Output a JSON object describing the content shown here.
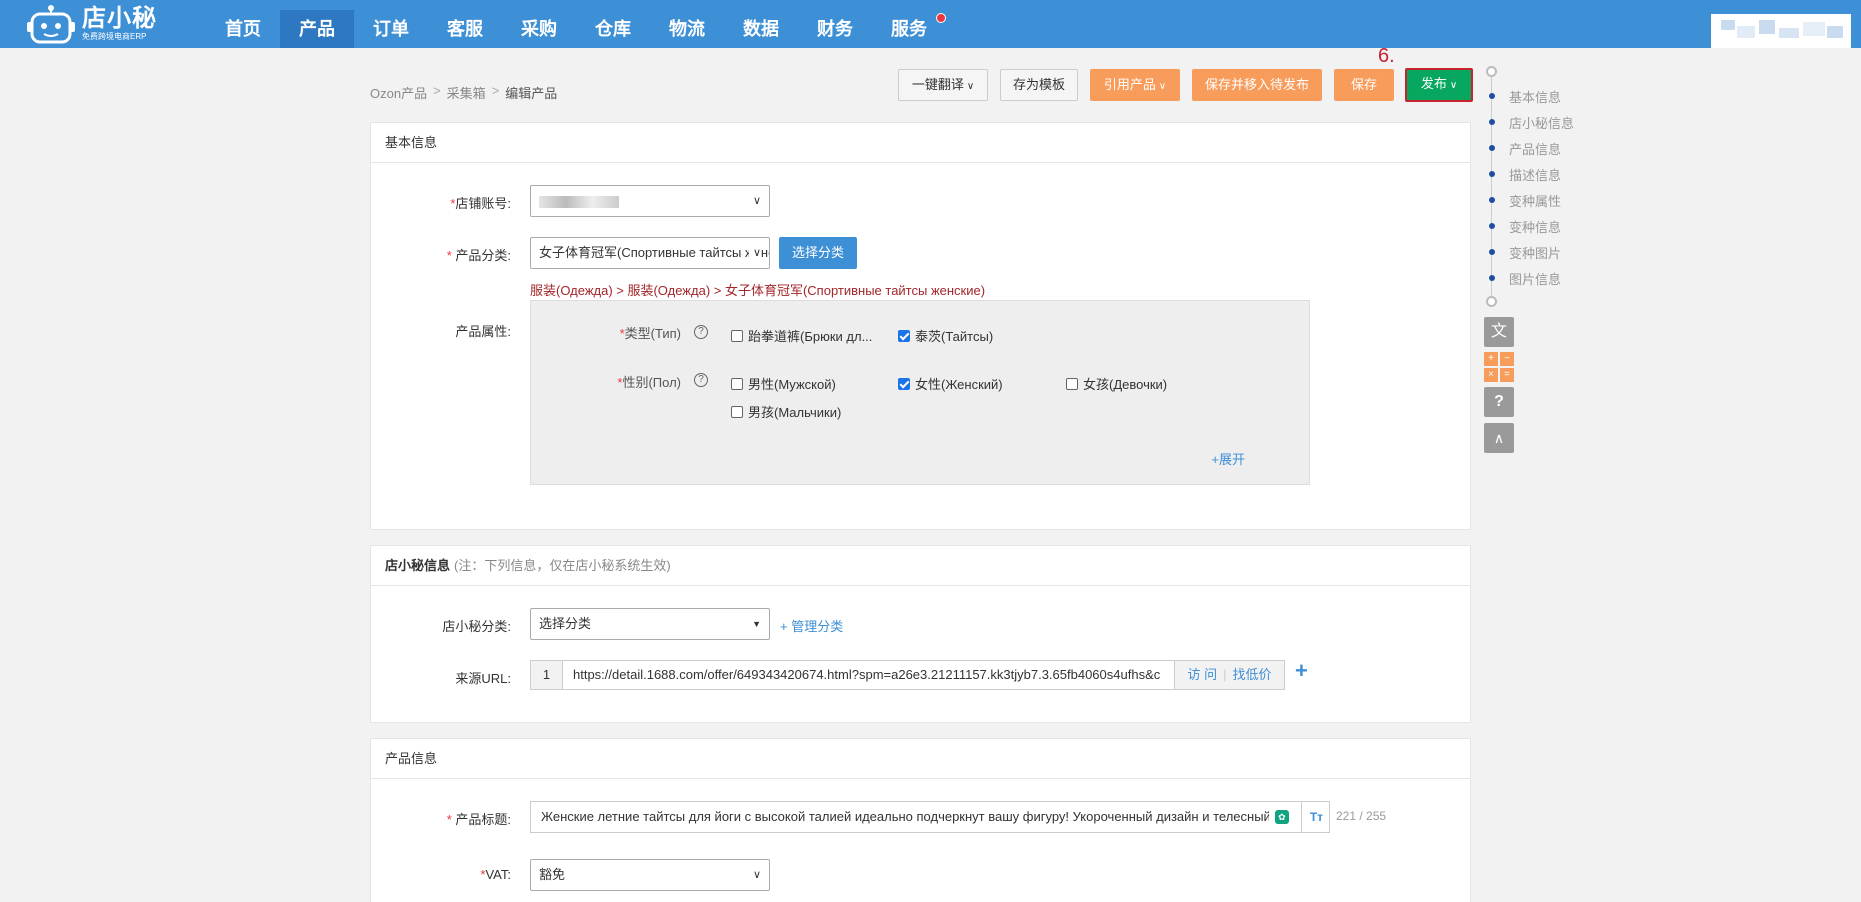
{
  "app": {
    "logo_name": "店小秘",
    "logo_sub": "免费跨境电商ERP"
  },
  "nav": {
    "items": [
      "首页",
      "产品",
      "订单",
      "客服",
      "采购",
      "仓库",
      "物流",
      "数据",
      "财务",
      "服务"
    ],
    "active_index": 1
  },
  "breadcrumb": [
    "Ozon产品",
    "采集箱",
    "编辑产品"
  ],
  "toolbar": {
    "translate_label": "一键翻译",
    "save_template_label": "存为模板",
    "cite_product_label": "引用产品",
    "save_move_label": "保存并移入待发布",
    "save_label": "保存",
    "publish_label": "发布",
    "step_label": "6."
  },
  "anchors": [
    "基本信息",
    "店小秘信息",
    "产品信息",
    "描述信息",
    "变种属性",
    "变种信息",
    "变种图片",
    "图片信息"
  ],
  "basic": {
    "header": "基本信息",
    "shop_label": "店铺账号:",
    "category_label": "产品分类:",
    "category_value": "女子体育冠军(Спортивные тайтсы женские)",
    "select_category_label": "选择分类",
    "category_path": "服装(Одежда) > 服装(Одежда) > 女子体育冠军(Спортивные тайтсы женские)",
    "attrs_label": "产品属性:",
    "type_label": "类型(Тип)",
    "type_options": [
      {
        "label": "跆拳道裤(Брюки дл...",
        "checked": false
      },
      {
        "label": "泰茨(Тайтсы)",
        "checked": true
      }
    ],
    "gender_label": "性别(Пол)",
    "gender_options": [
      {
        "label": "男性(Мужской)",
        "checked": false
      },
      {
        "label": "女性(Женский)",
        "checked": true
      },
      {
        "label": "女孩(Девочки)",
        "checked": false
      },
      {
        "label": "男孩(Мальчики)",
        "checked": false
      }
    ],
    "expand_label": "+展开"
  },
  "dxm": {
    "header": "店小秘信息",
    "note": "(注：下列信息，仅在店小秘系统生效)",
    "category_label": "店小秘分类:",
    "category_value": "选择分类",
    "manage_label": "+ 管理分类",
    "url_label": "来源URL:",
    "url_index": "1",
    "url_value": "https://detail.1688.com/offer/649343420674.html?spm=a26e3.21211157.kk3tjyb7.3.65fb4060s4ufhs&c",
    "visit_label": "访 问",
    "find_price_label": "找低价",
    "add_label": "+"
  },
  "product": {
    "header": "产品信息",
    "title_label": "产品标题:",
    "title_value": "Женские летние тайтсы для йоги с высокой талией идеально подчеркнут вашу фигуру! Укороченный дизайн и телесный",
    "title_counter": "221 / 255",
    "vat_label": "VAT:",
    "vat_value": "豁免"
  }
}
